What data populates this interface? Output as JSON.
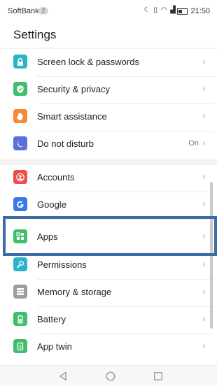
{
  "statusbar": {
    "carrier": "SoftBank",
    "badge": "2",
    "time": "21:50",
    "icons": [
      "do-not-disturb-icon",
      "vibrate-icon",
      "wifi-icon",
      "signal-icon",
      "battery-icon"
    ]
  },
  "page": {
    "title": "Settings"
  },
  "groups": [
    {
      "items": [
        {
          "label": "Screen lock & passwords",
          "icon": "lock-icon",
          "color": "#2bb3c7",
          "value": ""
        },
        {
          "label": "Security & privacy",
          "icon": "shield-icon",
          "color": "#3fbf6d",
          "value": ""
        },
        {
          "label": "Smart assistance",
          "icon": "hand-icon",
          "color": "#f38a3a",
          "value": ""
        },
        {
          "label": "Do not disturb",
          "icon": "moon-icon",
          "color": "#5a6fd8",
          "value": "On"
        }
      ]
    },
    {
      "items": [
        {
          "label": "Accounts",
          "icon": "account-icon",
          "color": "#ec4e4e",
          "value": ""
        },
        {
          "label": "Google",
          "icon": "google-icon",
          "color": "#3b78e7",
          "value": ""
        },
        {
          "label": "Apps",
          "icon": "apps-grid-icon",
          "color": "#3fbf6d",
          "value": ""
        },
        {
          "label": "Permissions",
          "icon": "key-icon",
          "color": "#2bb3c7",
          "value": ""
        },
        {
          "label": "Memory & storage",
          "icon": "storage-icon",
          "color": "#9e9e9e",
          "value": ""
        },
        {
          "label": "Battery",
          "icon": "battery-icon",
          "color": "#3fbf6d",
          "value": ""
        },
        {
          "label": "App twin",
          "icon": "app-twin-icon",
          "color": "#3fbf6d",
          "value": ""
        }
      ]
    }
  ],
  "navbar": {
    "buttons": [
      "back-icon",
      "home-icon",
      "recents-icon"
    ]
  }
}
